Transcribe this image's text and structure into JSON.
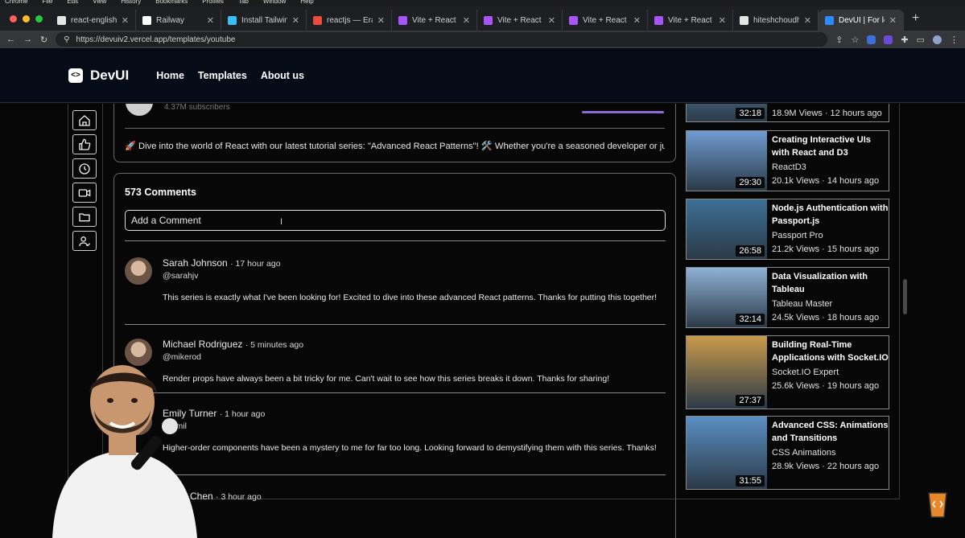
{
  "mac_menu": [
    "Chrome",
    "File",
    "Edit",
    "View",
    "History",
    "Bookmarks",
    "Profiles",
    "Tab",
    "Window",
    "Help"
  ],
  "tabs": [
    {
      "label": "react-english/Re",
      "color": "#e6e6e6"
    },
    {
      "label": "Railway",
      "color": "#ffffff"
    },
    {
      "label": "Install Tailwind CS",
      "color": "#38bdf8"
    },
    {
      "label": "reactjs — Eraser",
      "color": "#e94b3c"
    },
    {
      "label": "Vite + React",
      "color": "#a855f7"
    },
    {
      "label": "Vite + React",
      "color": "#a855f7"
    },
    {
      "label": "Vite + React",
      "color": "#a855f7"
    },
    {
      "label": "Vite + React",
      "color": "#a855f7"
    },
    {
      "label": "hiteshchoudhary/",
      "color": "#e6e6e6"
    },
    {
      "label": "DevUI | For learn",
      "color": "#2b8cff"
    }
  ],
  "address": {
    "url": "https://devuiv2.vercel.app/templates/youtube"
  },
  "site": {
    "logo_symbol": "<>",
    "brand": "DevUI",
    "nav": [
      "Home",
      "Templates",
      "About us"
    ]
  },
  "sidebar_icons": [
    "home-icon",
    "thumbs-up-icon",
    "history-icon",
    "video-icon",
    "folder-icon",
    "user-check-icon"
  ],
  "description": {
    "subscribers": "4.37M subscribers",
    "text": "🚀 Dive into the world of React with our latest tutorial series: \"Advanced React Patterns\"! 🛠️ Whether you're a seasoned developer or just"
  },
  "comments": {
    "count_label": "573 Comments",
    "input_placeholder": "Add a Comment",
    "items": [
      {
        "name": "Sarah Johnson",
        "time": "· 17 hour ago",
        "handle": "@sarahjv",
        "text": "This series is exactly what I've been looking for! Excited to dive into these advanced React patterns. Thanks for putting this together!"
      },
      {
        "name": "Michael Rodriguez",
        "time": "· 5 minutes ago",
        "handle": "@mikerod",
        "text": "Render props have always been a bit tricky for me. Can't wait to see how this series breaks it down. Thanks for sharing!"
      },
      {
        "name": "Emily Turner",
        "time": "· 1 hour ago",
        "handle": "@emil",
        "text": "Higher-order components have been a mystery to me for far too long. Looking forward to demystifying them with this series. Thanks!"
      },
      {
        "name": "David Chen",
        "time": "· 3 hour ago",
        "handle": "",
        "text": ""
      }
    ]
  },
  "videos": [
    {
      "title": "",
      "channel": "",
      "meta": "18.9M Views · 12 hours ago",
      "duration": "32:18",
      "thumb": "#4b6b8a"
    },
    {
      "title": "Creating Interactive UIs with React and D3",
      "channel": "ReactD3",
      "meta": "20.1k Views · 14 hours ago",
      "duration": "29:30",
      "thumb": "#6f9bd1"
    },
    {
      "title": "Node.js Authentication with Passport.js",
      "channel": "Passport Pro",
      "meta": "21.2k Views · 15 hours ago",
      "duration": "26:58",
      "thumb": "#3d6f96"
    },
    {
      "title": "Data Visualization with Tableau",
      "channel": "Tableau Master",
      "meta": "24.5k Views · 18 hours ago",
      "duration": "32:14",
      "thumb": "#8fb2d6"
    },
    {
      "title": "Building Real-Time Applications with Socket.IO",
      "channel": "Socket.IO Expert",
      "meta": "25.6k Views · 19 hours ago",
      "duration": "27:37",
      "thumb": "#c99a4a"
    },
    {
      "title": "Advanced CSS: Animations and Transitions",
      "channel": "CSS Animations",
      "meta": "28.9k Views · 22 hours ago",
      "duration": "31:55",
      "thumb": "#5a8fc4"
    }
  ]
}
